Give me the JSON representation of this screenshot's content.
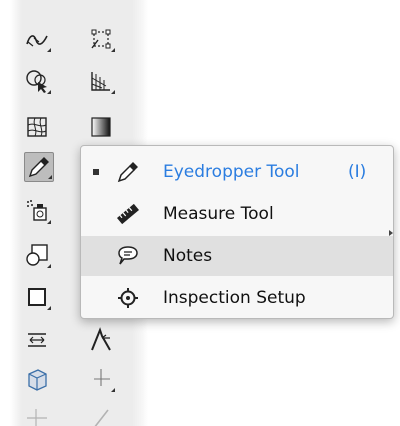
{
  "colors": {
    "accent": "#2b7de0",
    "menu_background": "#f7f7f7",
    "menu_highlight": "#e0e0e0",
    "toolbar_background": "#ececec",
    "active_tool": "#bdbdbd"
  },
  "toolbar": {
    "tools": [
      {
        "name": "width-tool-icon"
      },
      {
        "name": "free-transform-tool-icon"
      },
      {
        "name": "shape-builder-tool-icon"
      },
      {
        "name": "perspective-grid-tool-icon"
      },
      {
        "name": "mesh-tool-icon"
      },
      {
        "name": "gradient-tool-icon"
      },
      {
        "name": "eyedropper-tool-icon",
        "active": true
      },
      {
        "name": "symbol-sprayer-tool-icon"
      },
      {
        "name": "blend-tool-icon"
      },
      {
        "name": "column-graph-tool-icon"
      },
      {
        "name": "artboard-tool-icon"
      },
      {
        "name": "slice-tool-icon"
      },
      {
        "name": "eraser-tool-icon"
      },
      {
        "name": "scissors-tool-icon"
      }
    ]
  },
  "flyout": {
    "items": [
      {
        "label": "Eyedropper Tool",
        "shortcut": "(I)",
        "icon": "eyedropper-icon",
        "selected": true
      },
      {
        "label": "Measure Tool",
        "icon": "ruler-icon"
      },
      {
        "label": "Notes",
        "icon": "speech-bubble-icon",
        "highlighted": true
      },
      {
        "label": "Inspection Setup",
        "icon": "crosshair-target-icon"
      }
    ]
  }
}
